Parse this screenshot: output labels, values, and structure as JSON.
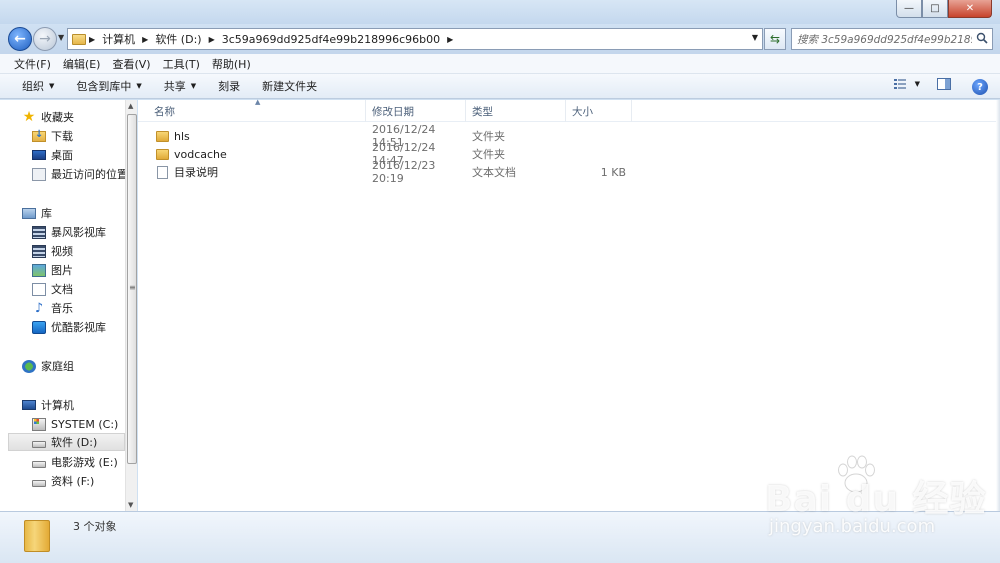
{
  "window": {
    "controls": {
      "minimize": "—",
      "maximize": "□",
      "close": "✕"
    }
  },
  "address": {
    "crumbs": [
      "计算机",
      "软件 (D:)",
      "3c59a969dd925df4e99b218996c96b00"
    ],
    "search_placeholder": "搜索 3c59a969dd925df4e99b2189..."
  },
  "menubar": {
    "items": [
      "文件(F)",
      "编辑(E)",
      "查看(V)",
      "工具(T)",
      "帮助(H)"
    ]
  },
  "toolbar": {
    "organize": "组织",
    "include_library": "包含到库中",
    "share": "共享",
    "burn": "刻录",
    "new_folder": "新建文件夹",
    "help": "?"
  },
  "nav": {
    "favorites": "收藏夹",
    "downloads": "下载",
    "desktop": "桌面",
    "recent": "最近访问的位置",
    "libraries": "库",
    "storm": "暴风影视库",
    "videos": "视频",
    "pictures": "图片",
    "documents": "文档",
    "music": "音乐",
    "youku": "优酷影视库",
    "homegroup": "家庭组",
    "computer": "计算机",
    "drive_c": "SYSTEM (C:)",
    "drive_d": "软件 (D:)",
    "drive_e": "电影游戏 (E:)",
    "drive_f": "资料 (F:)"
  },
  "columns": {
    "name": "名称",
    "date": "修改日期",
    "type": "类型",
    "size": "大小"
  },
  "files": [
    {
      "name": "hls",
      "date": "2016/12/24 14:51",
      "type": "文件夹",
      "size": "",
      "icon": "folder-icon"
    },
    {
      "name": "vodcache",
      "date": "2016/12/24 14:47",
      "type": "文件夹",
      "size": "",
      "icon": "folder-icon"
    },
    {
      "name": "目录说明",
      "date": "2016/12/23 20:19",
      "type": "文本文档",
      "size": "1 KB",
      "icon": "text-file-icon"
    }
  ],
  "status": {
    "count": "3 个对象"
  },
  "watermark": {
    "logo": "Bai du 经验",
    "url": "jingyan.baidu.com"
  }
}
